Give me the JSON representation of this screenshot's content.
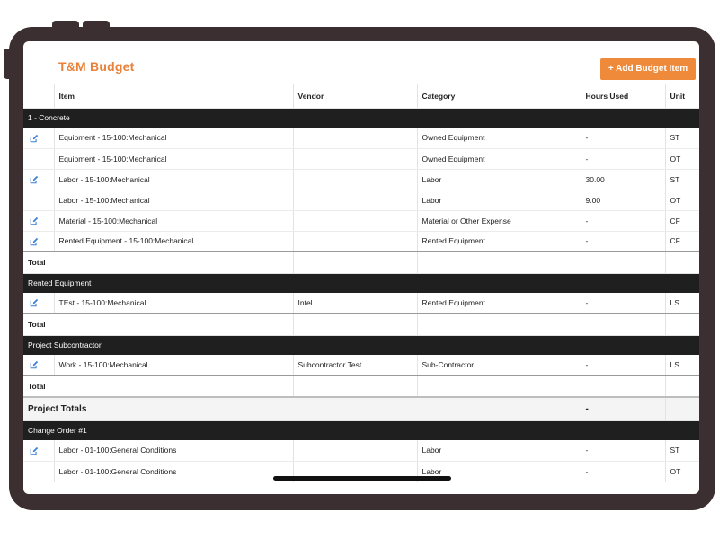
{
  "header": {
    "title": "T&M Budget",
    "add_button_label": "+ Add Budget Item"
  },
  "columns": {
    "item": "Item",
    "vendor": "Vendor",
    "category": "Category",
    "hours_used": "Hours Used",
    "unit": "Unit"
  },
  "total_label": "Total",
  "project_totals": {
    "label": "Project Totals",
    "hours": "-"
  },
  "sections": [
    {
      "name": "1 - Concrete",
      "rows": [
        {
          "edit": true,
          "item": "Equipment - 15-100:Mechanical",
          "vendor": "",
          "category": "Owned Equipment",
          "hours": "-",
          "unit": "ST"
        },
        {
          "edit": false,
          "item": "Equipment - 15-100:Mechanical",
          "vendor": "",
          "category": "Owned Equipment",
          "hours": "-",
          "unit": "OT"
        },
        {
          "edit": true,
          "item": "Labor - 15-100:Mechanical",
          "vendor": "",
          "category": "Labor",
          "hours": "30.00",
          "unit": "ST"
        },
        {
          "edit": false,
          "item": "Labor - 15-100:Mechanical",
          "vendor": "",
          "category": "Labor",
          "hours": "9.00",
          "unit": "OT"
        },
        {
          "edit": true,
          "item": "Material - 15-100:Mechanical",
          "vendor": "",
          "category": "Material or Other Expense",
          "hours": "-",
          "unit": "CF"
        },
        {
          "edit": true,
          "item": "Rented Equipment - 15-100:Mechanical",
          "vendor": "",
          "category": "Rented Equipment",
          "hours": "-",
          "unit": "CF"
        }
      ]
    },
    {
      "name": "Rented Equipment",
      "rows": [
        {
          "edit": true,
          "item": "TEst - 15-100:Mechanical",
          "vendor": "Intel",
          "category": "Rented Equipment",
          "hours": "-",
          "unit": "LS"
        }
      ]
    },
    {
      "name": "Project Subcontractor",
      "rows": [
        {
          "edit": true,
          "item": "Work - 15-100:Mechanical",
          "vendor": "Subcontractor Test",
          "category": "Sub-Contractor",
          "hours": "-",
          "unit": "LS"
        }
      ]
    }
  ],
  "change_order": {
    "name": "Change Order #1",
    "rows": [
      {
        "edit": true,
        "item": "Labor - 01-100:General Conditions",
        "vendor": "",
        "category": "Labor",
        "hours": "-",
        "unit": "ST"
      },
      {
        "edit": false,
        "item": "Labor - 01-100:General Conditions",
        "vendor": "",
        "category": "Labor",
        "hours": "-",
        "unit": "OT"
      }
    ]
  },
  "colors": {
    "accent": "#ef8a3b",
    "title": "#e8823a",
    "section_bg": "#1f1f1f",
    "edit_icon": "#3b7fd4",
    "device_frame": "#3c2f31"
  },
  "icons": {
    "edit": "edit-icon"
  }
}
